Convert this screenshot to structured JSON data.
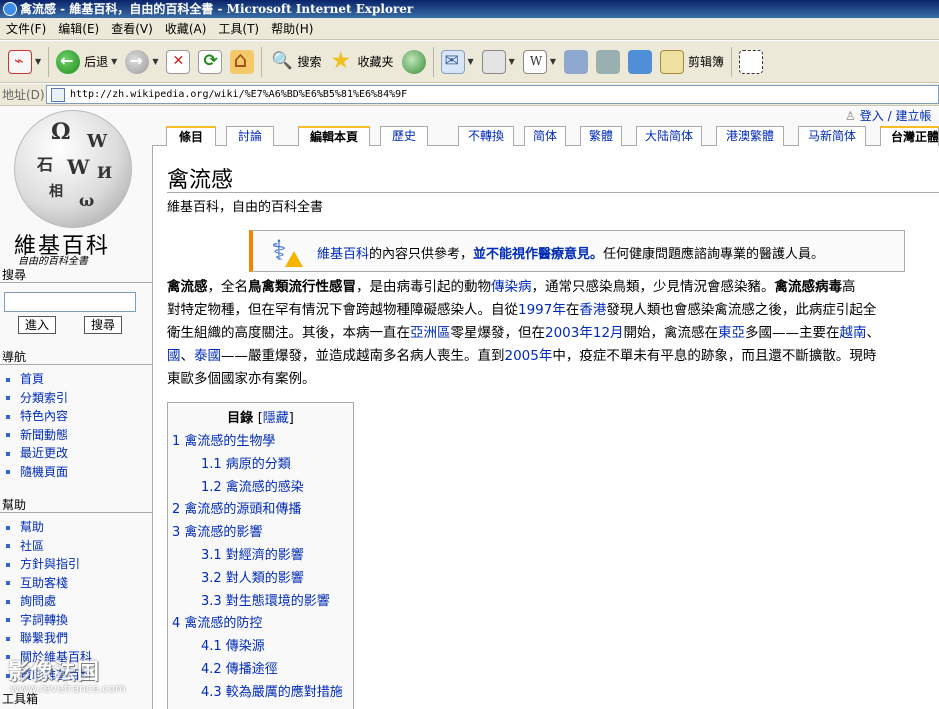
{
  "window": {
    "title": "禽流感 - 維基百科，自由的百科全書 - Microsoft Internet Explorer"
  },
  "menu": [
    "文件(F)",
    "编辑(E)",
    "查看(V)",
    "收藏(A)",
    "工具(T)",
    "帮助(H)"
  ],
  "toolbar": {
    "back_label": "后退",
    "search_label": "搜索",
    "favorites_label": "收藏夹",
    "clip_label": "剪辑簿"
  },
  "address": {
    "label": "地址(D)",
    "url": "http://zh.wikipedia.org/wiki/%E7%A6%BD%E6%B5%81%E6%84%9F"
  },
  "sidebar": {
    "logo_text": "維基百科",
    "logo_tagline": "自由的百科全書",
    "search_heading": "搜尋",
    "go_button": "進入",
    "search_button": "搜尋",
    "nav_heading": "導航",
    "nav_items": [
      "首頁",
      "分類索引",
      "特色內容",
      "新聞動態",
      "最近更改",
      "隨機頁面"
    ],
    "help_heading": "幫助",
    "help_items": [
      "幫助",
      "社區",
      "方針與指引",
      "互助客棧",
      "詢問處",
      "字詞轉換",
      "聯繫我們",
      "關於維基百科",
      "資助維基百科"
    ],
    "toolbox_heading": "工具箱",
    "watermark": "影像法国",
    "watermark_url": "www.revefrance.com"
  },
  "user_links": {
    "login": "登入 / 建立帳"
  },
  "tabs": [
    "條目",
    "討論",
    "編輯本頁",
    "歷史",
    "不轉換",
    "简体",
    "繁體",
    "大陆简体",
    "港澳繁體",
    "马新简体",
    "台灣正體"
  ],
  "content": {
    "title": "禽流感",
    "subtitle": "維基百科，自由的百科全書",
    "notice": {
      "link": "維基百科",
      "text1": "的內容只供參考，",
      "bold": "並不能視作醫療意見。",
      "text2": "任何健康問題應諮詢專業的醫護人員。"
    },
    "para": {
      "l1_a": "禽流感",
      "l1_b": "，全名",
      "l1_c": "鳥禽類流行性感冒",
      "l1_d": "，是由病毒引起的動物",
      "l1_e": "傳染病",
      "l1_f": "，通常只感染鳥類，少見情況會感染豬。",
      "l1_g": "禽流感病毒",
      "l1_h": "高",
      "l2_a": "對特定物種，但在罕有情況下會跨越物種障礙感染人。自從",
      "l2_b": "1997年",
      "l2_c": "在",
      "l2_d": "香港",
      "l2_e": "發現人類也會感染禽流感之後，此病症引起全",
      "l3_a": "衛生組織的高度關注。其後，本病一直在",
      "l3_b": "亞洲區",
      "l3_c": "零星爆發，但在",
      "l3_d": "2003年12月",
      "l3_e": "開始，禽流感在",
      "l3_f": "東亞",
      "l3_g": "多國——主要在",
      "l3_h": "越南",
      "l3_i": "、",
      "l4_a": "國",
      "l4_b": "、",
      "l4_c": "泰國",
      "l4_d": "——嚴重爆發，並造成越南多名病人喪生。直到",
      "l4_e": "2005年",
      "l4_f": "中，疫症不單未有平息的跡象，而且還不斷擴散。現時",
      "l5_a": "東歐多個國家亦有案例。"
    },
    "toc": {
      "heading": "目錄",
      "hide_open": "[",
      "hide": "隱藏",
      "hide_close": "]",
      "items": [
        "1 禽流感的生物學",
        "1.1 病原的分類",
        "1.2 禽流感的感染",
        "2 禽流感的源頭和傳播",
        "3 禽流感的影響",
        "3.1 對經濟的影響",
        "3.2 對人類的影響",
        "3.3 對生態環境的影響",
        "4 禽流感的防控",
        "4.1 傳染源",
        "4.2 傳播途徑",
        "4.3 較為嚴厲的應對措施"
      ]
    }
  }
}
